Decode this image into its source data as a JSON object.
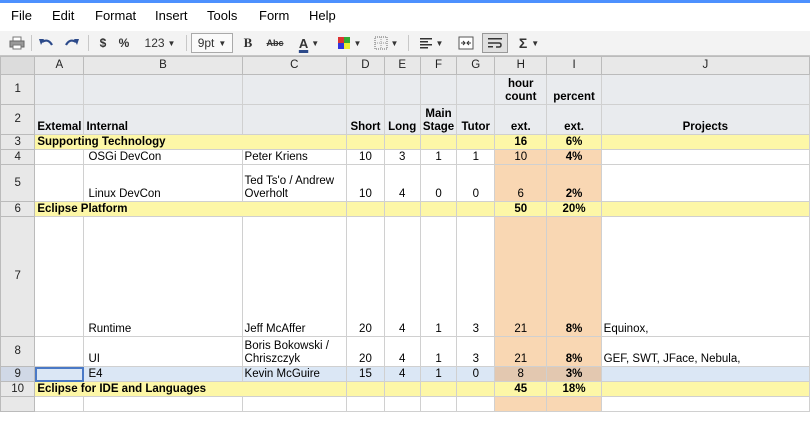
{
  "menu": [
    "File",
    "Edit",
    "Format",
    "Insert",
    "Tools",
    "Form",
    "Help"
  ],
  "toolbar": {
    "currency": "$",
    "percent": "%",
    "number_format": "123",
    "font_size": "9pt",
    "bold": "B",
    "strike": "Abc",
    "text_color": "A",
    "sum": "Σ"
  },
  "columns": [
    "A",
    "B",
    "C",
    "D",
    "E",
    "F",
    "G",
    "H",
    "I",
    "J"
  ],
  "rows": [
    {
      "num": "1",
      "cells": [
        "",
        "",
        "",
        "",
        "",
        "",
        "",
        "hour count",
        "percent",
        ""
      ]
    },
    {
      "num": "2",
      "cells": [
        "Extemal",
        "Internal",
        "",
        "Short",
        "Long",
        "Main Stage",
        "Tutor",
        "ext.",
        "ext.",
        "Projects"
      ]
    },
    {
      "num": "3",
      "cells": [
        "Supporting Technology",
        "",
        "",
        "",
        "",
        "",
        "",
        "16",
        "6%",
        ""
      ]
    },
    {
      "num": "4",
      "cells": [
        "",
        "OSGi DevCon",
        "Peter Kriens",
        "10",
        "3",
        "1",
        "1",
        "10",
        "4%",
        ""
      ]
    },
    {
      "num": "5",
      "cells": [
        "",
        "Linux DevCon",
        "Ted Ts'o / Andrew Overholt",
        "10",
        "4",
        "0",
        "0",
        "6",
        "2%",
        ""
      ]
    },
    {
      "num": "6",
      "cells": [
        "Eclipse Platform",
        "",
        "",
        "",
        "",
        "",
        "",
        "50",
        "20%",
        ""
      ]
    },
    {
      "num": "7",
      "cells": [
        "",
        "Runtime",
        "Jeff McAffer",
        "20",
        "4",
        "1",
        "3",
        "21",
        "8%",
        "Equinox,"
      ]
    },
    {
      "num": "8",
      "cells": [
        "",
        "UI",
        "Boris Bokowski / Chriszczyk",
        "20",
        "4",
        "1",
        "3",
        "21",
        "8%",
        "GEF, SWT, JFace, Nebula,"
      ]
    },
    {
      "num": "9",
      "cells": [
        "",
        "E4",
        "Kevin McGuire",
        "15",
        "4",
        "1",
        "0",
        "8",
        "3%",
        ""
      ]
    },
    {
      "num": "10",
      "cells": [
        "Eclipse for IDE and Languages",
        "",
        "",
        "",
        "",
        "",
        "",
        "45",
        "18%",
        ""
      ]
    },
    {
      "num": "",
      "cells": [
        "",
        "",
        "",
        "",
        "",
        "",
        "",
        "",
        "",
        ""
      ]
    }
  ]
}
